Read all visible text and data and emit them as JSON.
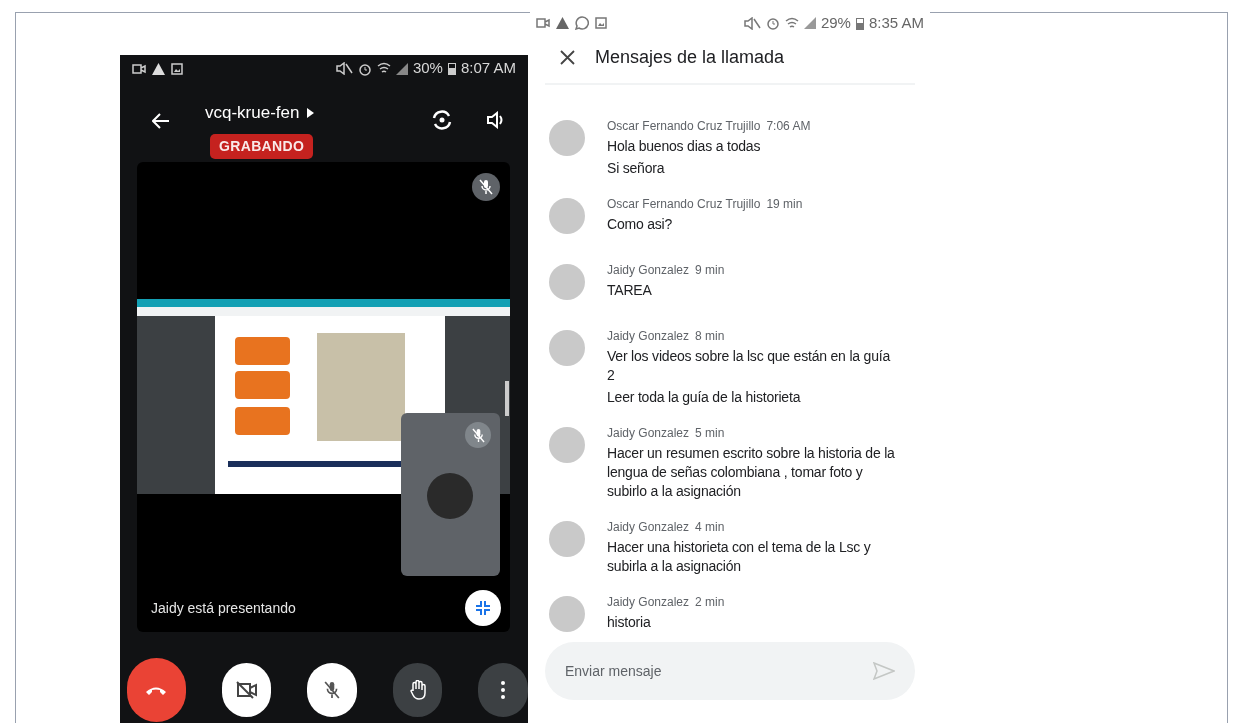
{
  "call_screen": {
    "status_bar": {
      "battery": "30%",
      "time": "8:07 AM"
    },
    "meeting_code": "vcq-krue-fen",
    "recording_badge": "GRABANDO",
    "presenter_caption": "Jaidy está presentando"
  },
  "chat_screen": {
    "status_bar": {
      "battery": "29%",
      "time": "8:35 AM"
    },
    "title": "Mensajes de la llamada",
    "messages": [
      {
        "sender": "Oscar Fernando Cruz Trujillo",
        "time": "7:06 AM",
        "lines": [
          "Hola buenos dias a todas",
          "Si señora"
        ]
      },
      {
        "sender": "Oscar Fernando Cruz Trujillo",
        "time": "19 min",
        "lines": [
          "Como asi?"
        ]
      },
      {
        "sender": "Jaidy Gonzalez",
        "time": "9 min",
        "lines": [
          "TAREA"
        ]
      },
      {
        "sender": "Jaidy Gonzalez",
        "time": "8 min",
        "lines": [
          "Ver los videos sobre la lsc que están en la guía 2",
          "Leer toda la guía de la historieta"
        ]
      },
      {
        "sender": "Jaidy Gonzalez",
        "time": "5 min",
        "lines": [
          "Hacer un resumen escrito sobre la historia de la lengua de señas colombiana , tomar foto y subirlo a la asignación"
        ]
      },
      {
        "sender": "Jaidy Gonzalez",
        "time": "4 min",
        "lines": [
          "Hacer una historieta con el tema de la Lsc y subirla a la asignación"
        ]
      },
      {
        "sender": "Jaidy Gonzalez",
        "time": "2 min",
        "lines": [
          "historia"
        ]
      }
    ],
    "input": {
      "placeholder": "Enviar mensaje"
    }
  }
}
